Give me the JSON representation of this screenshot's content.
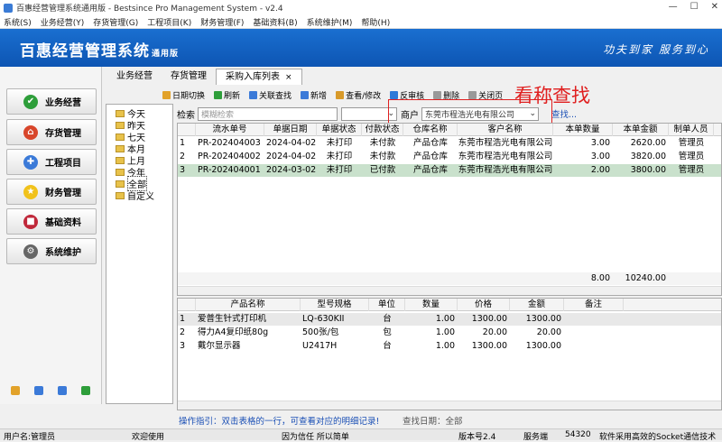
{
  "window": {
    "title": "百惠经营管理系统通用版 - Bestsince Pro Management System - v2.4",
    "controls": [
      "—",
      "☐",
      "✕"
    ]
  },
  "menu": [
    "系统(S)",
    "业务经营(Y)",
    "存货管理(G)",
    "工程项目(K)",
    "财务管理(F)",
    "基础资料(B)",
    "系统维护(M)",
    "帮助(H)"
  ],
  "banner": {
    "brand": "百惠经营管理系统",
    "edition": "通用版",
    "slogan": "功夫到家 服务到心"
  },
  "nav": [
    {
      "label": "业务经营",
      "color": "#2e9e3a",
      "glyph": "✔"
    },
    {
      "label": "存货管理",
      "color": "#d8462b",
      "glyph": "⌂"
    },
    {
      "label": "工程项目",
      "color": "#3b7ad8",
      "glyph": "✚"
    },
    {
      "label": "财务管理",
      "color": "#f1c21b",
      "glyph": "★"
    },
    {
      "label": "基础资料",
      "color": "#c0283a",
      "glyph": "■"
    },
    {
      "label": "系统维护",
      "color": "#666666",
      "glyph": "⚙"
    }
  ],
  "tabs": [
    {
      "label": "业务经营"
    },
    {
      "label": "存货管理"
    },
    {
      "label": "采购入库列表",
      "close": "×"
    }
  ],
  "toolbar": [
    {
      "label": "日期切换",
      "color": "#e2a22a"
    },
    {
      "label": "刷新",
      "color": "#2e9e3a"
    },
    {
      "label": "关联查找",
      "color": "#3b7ad8"
    },
    {
      "label": "新增",
      "color": "#3b7ad8"
    },
    {
      "label": "查看/修改",
      "color": "#d89a2a"
    },
    {
      "label": "反审核",
      "color": "#2e7ad8"
    },
    {
      "label": "删除",
      "color": "#999999"
    },
    {
      "label": "关闭页",
      "color": "#999999"
    }
  ],
  "overlay_text": "看称查找",
  "tree": [
    "今天",
    "昨天",
    "七天",
    "本月",
    "上月",
    "今年",
    "全部",
    "自定义"
  ],
  "search": {
    "label": "检索",
    "placeholder": "模糊检索",
    "customer_label": "商户",
    "customer_value": "东莞市程浩光电有限公司",
    "find": "查找..."
  },
  "orders": {
    "headers": [
      "流水单号",
      "单据日期",
      "单据状态",
      "付款状态",
      "仓库名称",
      "客户名称",
      "本单数量",
      "本单金额",
      "制单人员"
    ],
    "rows": [
      {
        "no": "1",
        "code": "PR-202404003",
        "date": "2024-04-02",
        "status": "未打印",
        "pay": "未付款",
        "wh": "产品仓库",
        "cust": "东莞市程浩光电有限公司",
        "qty": "3.00",
        "amt": "2620.00",
        "user": "管理员"
      },
      {
        "no": "2",
        "code": "PR-202404002",
        "date": "2024-04-02",
        "status": "未打印",
        "pay": "未付款",
        "wh": "产品仓库",
        "cust": "东莞市程浩光电有限公司",
        "qty": "3.00",
        "amt": "3820.00",
        "user": "管理员"
      },
      {
        "no": "3",
        "code": "PR-202404001",
        "date": "2024-03-02",
        "status": "未打印",
        "pay": "已付款",
        "wh": "产品仓库",
        "cust": "东莞市程浩光电有限公司",
        "qty": "2.00",
        "amt": "3800.00",
        "user": "管理员"
      }
    ],
    "total_qty": "8.00",
    "total_amt": "10240.00"
  },
  "items": {
    "headers": [
      "产品名称",
      "型号规格",
      "单位",
      "数量",
      "价格",
      "金额",
      "备注"
    ],
    "rows": [
      {
        "no": "1",
        "name": "爱普生针式打印机",
        "model": "LQ-630KII",
        "unit": "台",
        "qty": "1.00",
        "price": "1300.00",
        "amt": "1300.00"
      },
      {
        "no": "2",
        "name": "得力A4复印纸80g",
        "model": "500张/包",
        "unit": "包",
        "qty": "1.00",
        "price": "20.00",
        "amt": "20.00"
      },
      {
        "no": "3",
        "name": "戴尔显示器",
        "model": "U2417H",
        "unit": "台",
        "qty": "1.00",
        "price": "1300.00",
        "amt": "1300.00"
      }
    ]
  },
  "hint": "操作指引：双击表格的一行，可查看对应的明细记录!",
  "query_date": "查找日期：全部",
  "status": {
    "user": "用户名:管理员",
    "welcome": "欢迎使用",
    "motto": "因为信任 所以简单",
    "version": "版本号2.4",
    "server": "服务端",
    "port": "54320",
    "tech": "软件采用高效的Socket通信技术"
  }
}
